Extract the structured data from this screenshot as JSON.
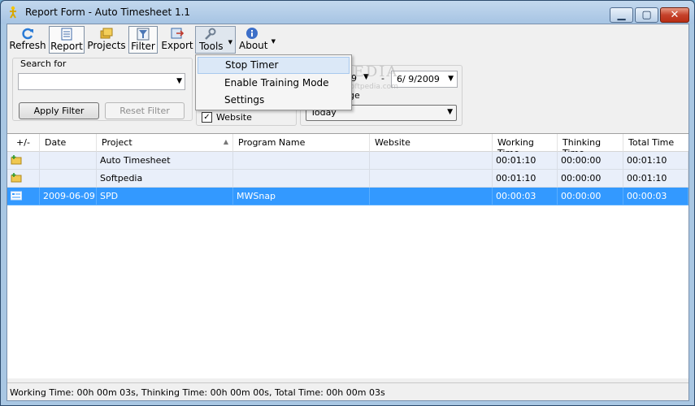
{
  "window": {
    "title": "Report Form - Auto Timesheet 1.1"
  },
  "toolbar": {
    "refresh": "Refresh",
    "report": "Report",
    "projects": "Projects",
    "filter": "Filter",
    "export": "Export",
    "tools": "Tools",
    "about": "About"
  },
  "tools_menu": {
    "items": [
      "Stop Timer",
      "Enable Training Mode",
      "Settings"
    ],
    "highlighted": "Stop Timer"
  },
  "filter": {
    "search_label": "Search for",
    "search_value": "",
    "apply_label": "Apply Filter",
    "reset_label": "Reset Filter",
    "website_checkbox_label": "Website",
    "website_checked": true,
    "date_from_visible": "9",
    "date_separator": "-",
    "date_to": "6/ 9/2009",
    "range_label_visible": "ge",
    "range_value": "Today"
  },
  "watermark": {
    "text": "SOFTPEDIA",
    "sub": "www.softpedia.com"
  },
  "table": {
    "columns": [
      "+/-",
      "Date",
      "Project",
      "Program Name",
      "Website",
      "Working Time",
      "Thinking Time",
      "Total Time"
    ],
    "rows": [
      {
        "kind": "group",
        "icon": "folder-add-icon",
        "date": "",
        "project": "Auto Timesheet",
        "program": "",
        "website": "",
        "working": "00:01:10",
        "thinking": "00:00:00",
        "total": "00:01:10"
      },
      {
        "kind": "group",
        "icon": "folder-add-icon",
        "date": "",
        "project": "Softpedia",
        "program": "",
        "website": "",
        "working": "00:01:10",
        "thinking": "00:00:00",
        "total": "00:01:10"
      },
      {
        "kind": "record",
        "icon": "record-icon",
        "date": "2009-06-09",
        "project": "SPD",
        "program": "MWSnap",
        "website": "",
        "working": "00:00:03",
        "thinking": "00:00:00",
        "total": "00:00:03"
      }
    ]
  },
  "status": {
    "text": "Working Time: 00h 00m 03s, Thinking Time: 00h 00m 00s, Total Time: 00h 00m 03s"
  },
  "colors": {
    "selection": "#3399ff",
    "group_row": "#e9effa",
    "titlebar": "#a7c4e3",
    "close_button": "#c5412a"
  }
}
